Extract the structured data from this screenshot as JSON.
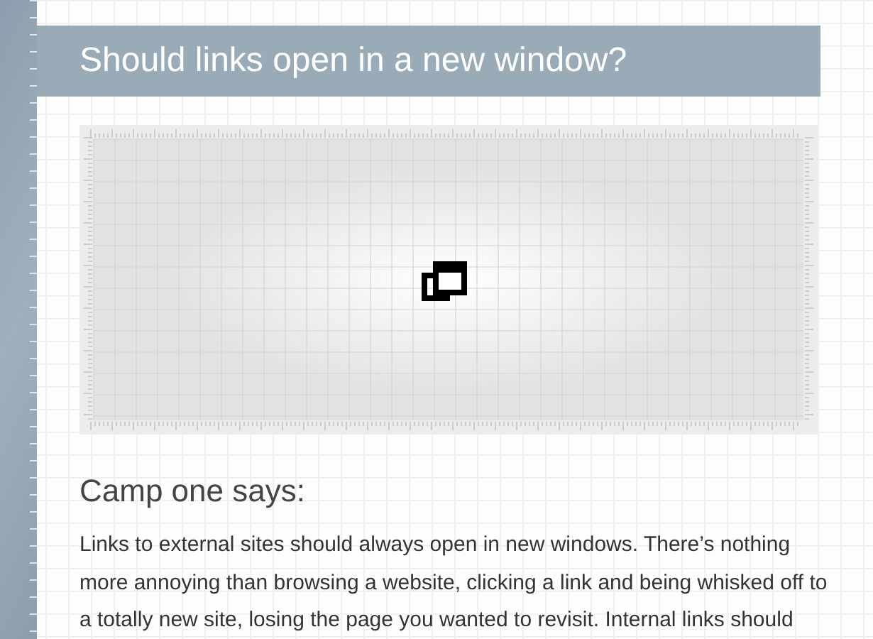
{
  "title": "Should links open in a new window?",
  "section": {
    "heading": "Camp one says:",
    "paragraph": "Links to external sites should always open in new windows. There’s nothing more annoying than browsing a website, clicking a link and being whisked off to a totally new site, losing the page you wanted to revisit. Internal links should"
  }
}
